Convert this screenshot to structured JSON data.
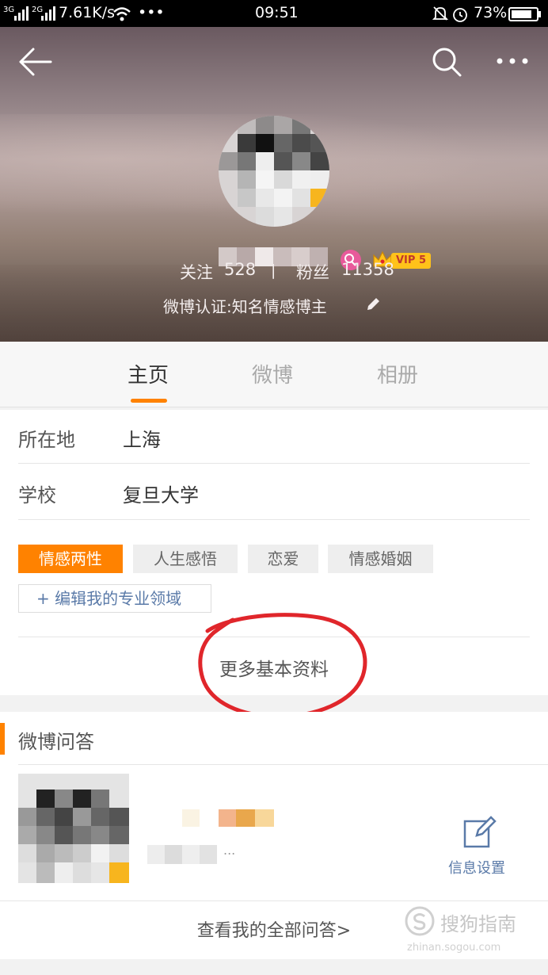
{
  "status_bar": {
    "signal1": "3G",
    "signal2": "2G",
    "speed": "7.61K/s",
    "more": "•••",
    "time": "09:51",
    "battery": "73%"
  },
  "profile": {
    "vip_label": "VIP 5",
    "following_label": "关注",
    "following_count": "528",
    "separator": "|",
    "fans_label": "粉丝",
    "fans_count": "11358",
    "verification": "微博认证:知名情感博主"
  },
  "tabs": [
    {
      "label": "主页",
      "active": true
    },
    {
      "label": "微博",
      "active": false
    },
    {
      "label": "相册",
      "active": false
    }
  ],
  "info": {
    "location_label": "所在地",
    "location_value": "上海",
    "school_label": "学校",
    "school_value": "复旦大学",
    "tags": [
      "情感两性",
      "人生感悟",
      "恋爱",
      "情感婚姻"
    ],
    "edit_field": "+ 编辑我的专业领域",
    "more_info": "更多基本资料"
  },
  "qa": {
    "title": "微博问答",
    "snippet": "...",
    "settings_label": "信息设置",
    "view_all": "查看我的全部问答>"
  },
  "watermark": {
    "brand": "搜狗指南",
    "domain": "zhinan.sogou.com"
  },
  "colors": {
    "accent": "#ff8200",
    "link": "#5a7aa8",
    "highlight_circle": "#e0262b"
  }
}
